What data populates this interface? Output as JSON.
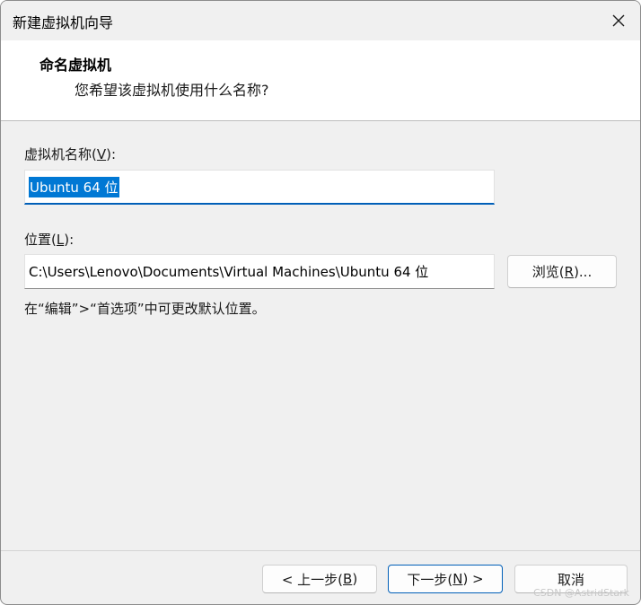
{
  "window": {
    "title": "新建虚拟机向导"
  },
  "header": {
    "title": "命名虚拟机",
    "subtitle": "您希望该虚拟机使用什么名称?"
  },
  "vm_name": {
    "label_pre": "虚拟机名称(",
    "label_key": "V",
    "label_post": "):",
    "value": "Ubuntu 64 位"
  },
  "location": {
    "label_pre": "位置(",
    "label_key": "L",
    "label_post": "):",
    "value": "C:\\Users\\Lenovo\\Documents\\Virtual Machines\\Ubuntu 64 位",
    "browse_pre": "浏览(",
    "browse_key": "R",
    "browse_post": ")..."
  },
  "hint": "在“编辑”>“首选项”中可更改默认位置。",
  "footer": {
    "back_pre": "< 上一步(",
    "back_key": "B",
    "back_post": ")",
    "next_pre": "下一步(",
    "next_key": "N",
    "next_post": ") >",
    "cancel": "取消"
  },
  "watermark": "CSDN @AstridStark",
  "colors": {
    "accent": "#005fb8",
    "selection": "#0078d4"
  }
}
